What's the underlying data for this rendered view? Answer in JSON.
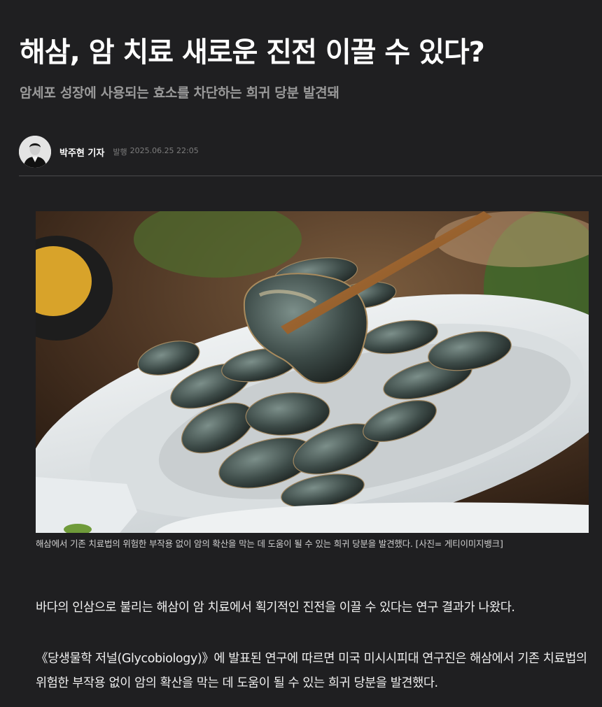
{
  "article": {
    "headline": "해삼, 암 치료 새로운 진전 이끌 수 있다?",
    "subheadline": "암세포 성장에 사용되는 효소를 차단하는 희귀 당분 발견돼",
    "byline": {
      "reporter": "박주현 기자",
      "published_label": "발행",
      "published_time": "2025.06.25 22:05"
    },
    "image": {
      "caption": "해삼에서 기존 치료법의 위험한 부작용 없이 암의 확산을 막는 데 도움이 될 수 있는 희귀 당분을 발견했다. [사진= 게티이미지뱅크]"
    },
    "paragraphs": [
      "바다의 인삼으로 불리는 해삼이 암 치료에서 획기적인 진전을 이끌 수 있다는 연구 결과가 나왔다.",
      "《당생물학 저널(Glycobiology)》에 발표된 연구에 따르면 미국 미시시피대 연구진은 해삼에서 기존 치료법의 위험한 부작용 없이 암의 확산을 막는 데 도움이 될 수 있는 희귀 당분을 발견했다."
    ]
  },
  "colors": {
    "background": "#1f1f21",
    "headline": "#ffffff",
    "subheadline": "#9a9a9a",
    "meta": "#7c7c7c"
  }
}
